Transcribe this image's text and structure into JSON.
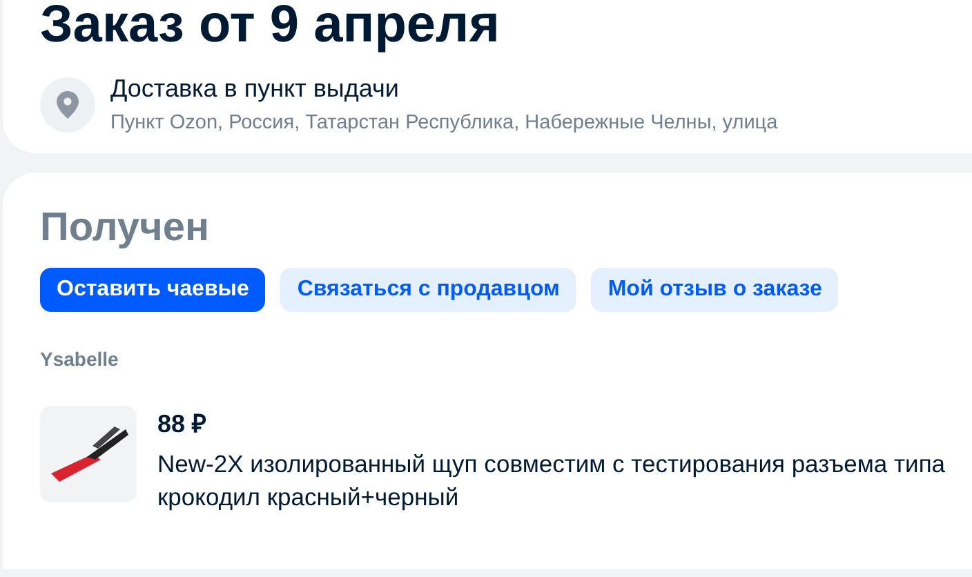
{
  "order": {
    "title": "Заказ от 9 апреля",
    "delivery": {
      "label": "Доставка в пункт выдачи",
      "address": "Пункт Ozon, Россия, Татарстан Республика, Набережные Челны, улица"
    }
  },
  "shipment": {
    "status": "Получен",
    "actions": [
      {
        "label": "Оставить чаевые",
        "kind": "primary"
      },
      {
        "label": "Связаться с продавцом",
        "kind": "secondary"
      },
      {
        "label": "Мой отзыв о заказе",
        "kind": "secondary"
      }
    ],
    "seller": "Ysabelle",
    "items": [
      {
        "price": "88 ₽",
        "title": "New-2X изолированный щуп совместим с тестирования разъема типа крокодил красный+черный"
      }
    ]
  }
}
